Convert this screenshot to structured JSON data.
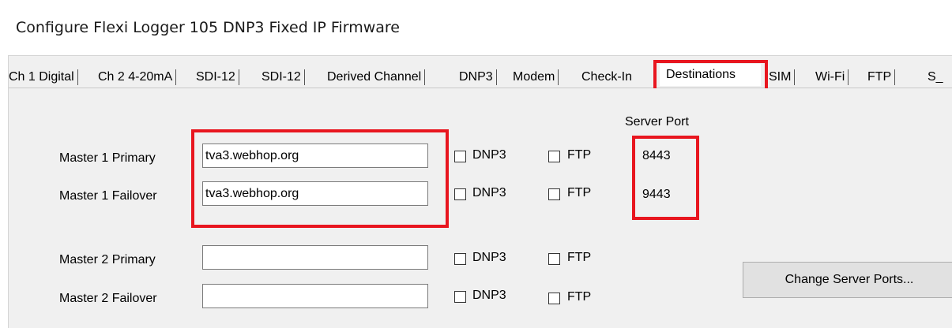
{
  "window": {
    "title": "Configure Flexi Logger 105 DNP3 Fixed IP Firmware"
  },
  "tabs": [
    {
      "label": "Ch 1 Digital"
    },
    {
      "label": "Ch 2 4-20mA"
    },
    {
      "label": "SDI-12"
    },
    {
      "label": "SDI-12"
    },
    {
      "label": "Derived Channel"
    },
    {
      "label": "DNP3"
    },
    {
      "label": "Modem"
    },
    {
      "label": "Check-In"
    },
    {
      "label": "Destinations",
      "active": true
    },
    {
      "label": "SIM"
    },
    {
      "label": "Wi-Fi"
    },
    {
      "label": "FTP"
    },
    {
      "label": "S_"
    }
  ],
  "destinations": {
    "server_port_header": "Server Port",
    "dnp3_label": "DNP3",
    "ftp_label": "FTP",
    "rows": [
      {
        "label": "Master 1 Primary",
        "host": "tva3.webhop.org",
        "dnp3": false,
        "ftp": false,
        "port": "8443"
      },
      {
        "label": "Master 1 Failover",
        "host": "tva3.webhop.org",
        "dnp3": false,
        "ftp": false,
        "port": "9443"
      },
      {
        "label": "Master 2 Primary",
        "host": "",
        "dnp3": false,
        "ftp": false,
        "port": ""
      },
      {
        "label": "Master 2 Failover",
        "host": "",
        "dnp3": false,
        "ftp": false,
        "port": ""
      }
    ],
    "change_ports_label": "Change Server Ports..."
  },
  "highlight_color": "#e8161f"
}
